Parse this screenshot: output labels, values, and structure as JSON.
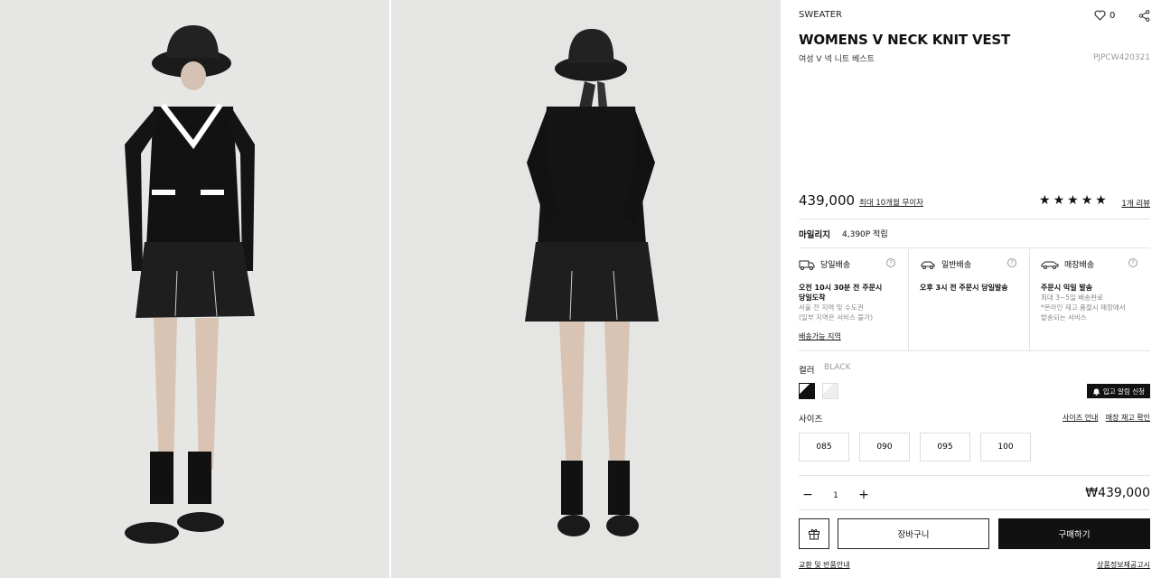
{
  "product": {
    "category": "SWEATER",
    "wish_count": "0",
    "title": "WOMENS V NECK KNIT VEST",
    "subtitle": "여성 V 넥 니트 베스트",
    "sku": "PJPCW420321",
    "price": "439,000",
    "installment": "최대 10개월 무이자",
    "stars": [
      "★",
      "★",
      "★",
      "★",
      "★"
    ],
    "reviews": "1개 리뷰"
  },
  "mileage": {
    "label": "마일리지",
    "value": "4,390P 적립"
  },
  "shipping": [
    {
      "icon": "truck-icon",
      "title": "당일배송",
      "help": "?",
      "strong": [
        "오전 10시 30분 전 주문시",
        "당일도착"
      ],
      "notes": [
        "서울 전 지역 및 수도권",
        "(일부 지역은 서비스 불가)"
      ],
      "link": "배송가능 지역"
    },
    {
      "icon": "car-icon",
      "title": "일반배송",
      "help": "?",
      "strong": [
        "오후 3시 전 주문시 당일발송"
      ],
      "notes": [],
      "link": ""
    },
    {
      "icon": "store-car-icon",
      "title": "매장배송",
      "help": "?",
      "strong": [
        "주문시 익일 발송"
      ],
      "notes": [
        "최대 3~5일 배송완료",
        "*온라인 재고 품절시 매장에서",
        "발송되는 서비스"
      ],
      "link": ""
    }
  ],
  "color": {
    "label": "컬러",
    "value": "BLACK",
    "notify": "입고 알림 신청"
  },
  "size": {
    "label": "사이즈",
    "guide": "사이즈 안내",
    "stock": "매장 재고 확인",
    "options": [
      "085",
      "090",
      "095",
      "100"
    ]
  },
  "quantity": {
    "minus": "−",
    "value": "1",
    "plus": "+"
  },
  "total": "₩439,000",
  "actions": {
    "cart": "장바구니",
    "buy": "구매하기"
  },
  "footer": {
    "left": "교환 및 반품안내",
    "right": "상품정보제공고시"
  }
}
